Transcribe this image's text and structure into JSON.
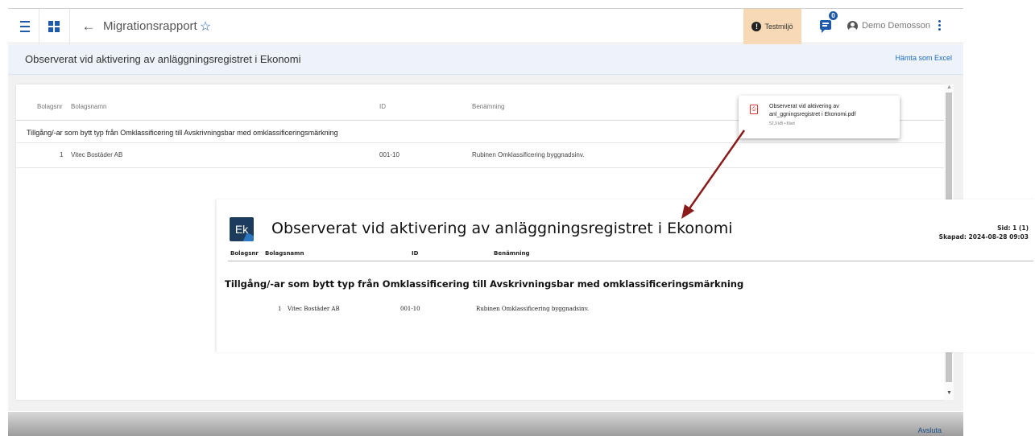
{
  "topbar": {
    "title": "Migrationsrapport",
    "menu_icon": "hamburger-menu-icon",
    "apps_icon": "grid-icon",
    "back_icon": "←",
    "star_icon": "☆",
    "env_label": "Testmiljö",
    "notifications_count": "0",
    "user_name": "Demo Demosson",
    "brand_color": "#1e5aa8",
    "env_color": "#f8d9b5"
  },
  "report": {
    "title": "Observerat vid aktivering av anläggningsregistret i Ekonomi",
    "export_label": "Hämta som Excel",
    "columns": {
      "bolagsnr": "Bolagsnr",
      "bolagsnamn": "Bolagsnamn",
      "id": "ID",
      "benamning": "Benämning"
    },
    "group_title": "Tillgång/-ar som bytt typ från Omklassificering till Avskrivningsbar med omklassificeringsmärkning",
    "row": {
      "nr": "1",
      "name": "Vitec Bostäder AB",
      "id": "001-10",
      "benamning": "Rubinen Omklassificering byggnadsinv."
    }
  },
  "download": {
    "file_name": "Observerat vid aktivering av anl_ggningsregistret i Ekonomi.pdf",
    "meta": "52,9 kB • Klart"
  },
  "pdf": {
    "logo_text": "Ek",
    "title": "Observerat vid aktivering av anläggningsregistret i Ekonomi",
    "page": "Sid: 1 (1)",
    "created": "Skapad: 2024-08-28 09:03",
    "columns": {
      "bolagsnr": "Bolagsnr",
      "bolagsnamn": "Bolagsnamn",
      "id": "ID",
      "benamning": "Benämning"
    },
    "group_title": "Tillgång/-ar som bytt typ från Omklassificering till Avskrivningsbar med omklassificeringsmärkning",
    "row": {
      "nr": "1",
      "name": "Vitec Bostäder AB",
      "id": "001-10",
      "benamning": "Rubinen Omklassificering byggnadsinv."
    }
  },
  "footer": {
    "exit_label": "Avsluta"
  }
}
